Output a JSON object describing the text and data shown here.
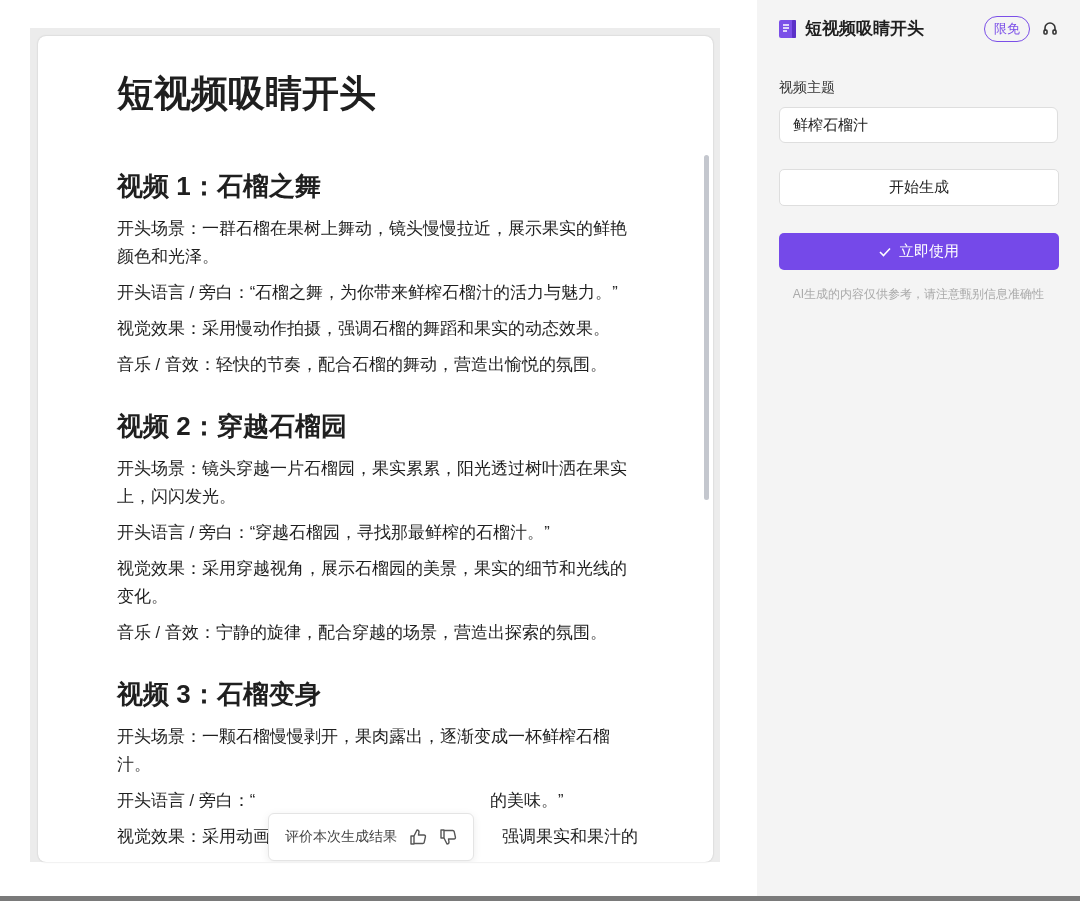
{
  "document": {
    "title": "短视频吸睛开头",
    "sections": [
      {
        "heading": "视频 1：石榴之舞",
        "paragraphs": [
          {
            "text": "开头场景：一群石榴在果树上舞动，镜头慢慢拉近，展示果实的鲜艳颜色和光泽。"
          },
          {
            "text": "开头语言 / 旁白：“石榴之舞，为你带来鲜榨石榴汁的活力与魅力。”"
          },
          {
            "text": "视觉效果：采用慢动作拍摄，强调石榴的舞蹈和果实的动态效果。"
          },
          {
            "text": "音乐 / 音效：轻快的节奏，配合石榴的舞动，营造出愉悦的氛围。"
          }
        ]
      },
      {
        "heading": "视频 2：穿越石榴园",
        "paragraphs": [
          {
            "text": "开头场景：镜头穿越一片石榴园，果实累累，阳光透过树叶洒在果实上，闪闪发光。"
          },
          {
            "text": "开头语言 / 旁白：“穿越石榴园，寻找那最鲜榨的石榴汁。”"
          },
          {
            "text": "视觉效果：采用穿越视角，展示石榴园的美景，果实的细节和光线的变化。"
          },
          {
            "text": "音乐 / 音效：宁静的旋律，配合穿越的场景，营造出探索的氛围。"
          }
        ]
      },
      {
        "heading": "视频 3：石榴变身",
        "paragraphs": [
          {
            "text": "开头场景：一颗石榴慢慢剥开，果肉露出，逐渐变成一杯鲜榨石榴汁。"
          },
          {
            "parts": [
              "开头语言 / 旁白：“",
              "的美味。”"
            ]
          },
          {
            "parts": [
              "视觉效果：采用动画",
              "强调果实和果汁的"
            ]
          }
        ]
      }
    ]
  },
  "rating": {
    "prompt": "评价本次生成结果"
  },
  "panel": {
    "app_title": "短视频吸睛开头",
    "badge": "限免",
    "field": {
      "label": "视频主题",
      "value": "鲜榨石榴汁"
    },
    "generate_button": "开始生成",
    "use_button": "立即使用",
    "disclaimer": "AI生成的内容仅供参考，请注意甄别信息准确性"
  }
}
